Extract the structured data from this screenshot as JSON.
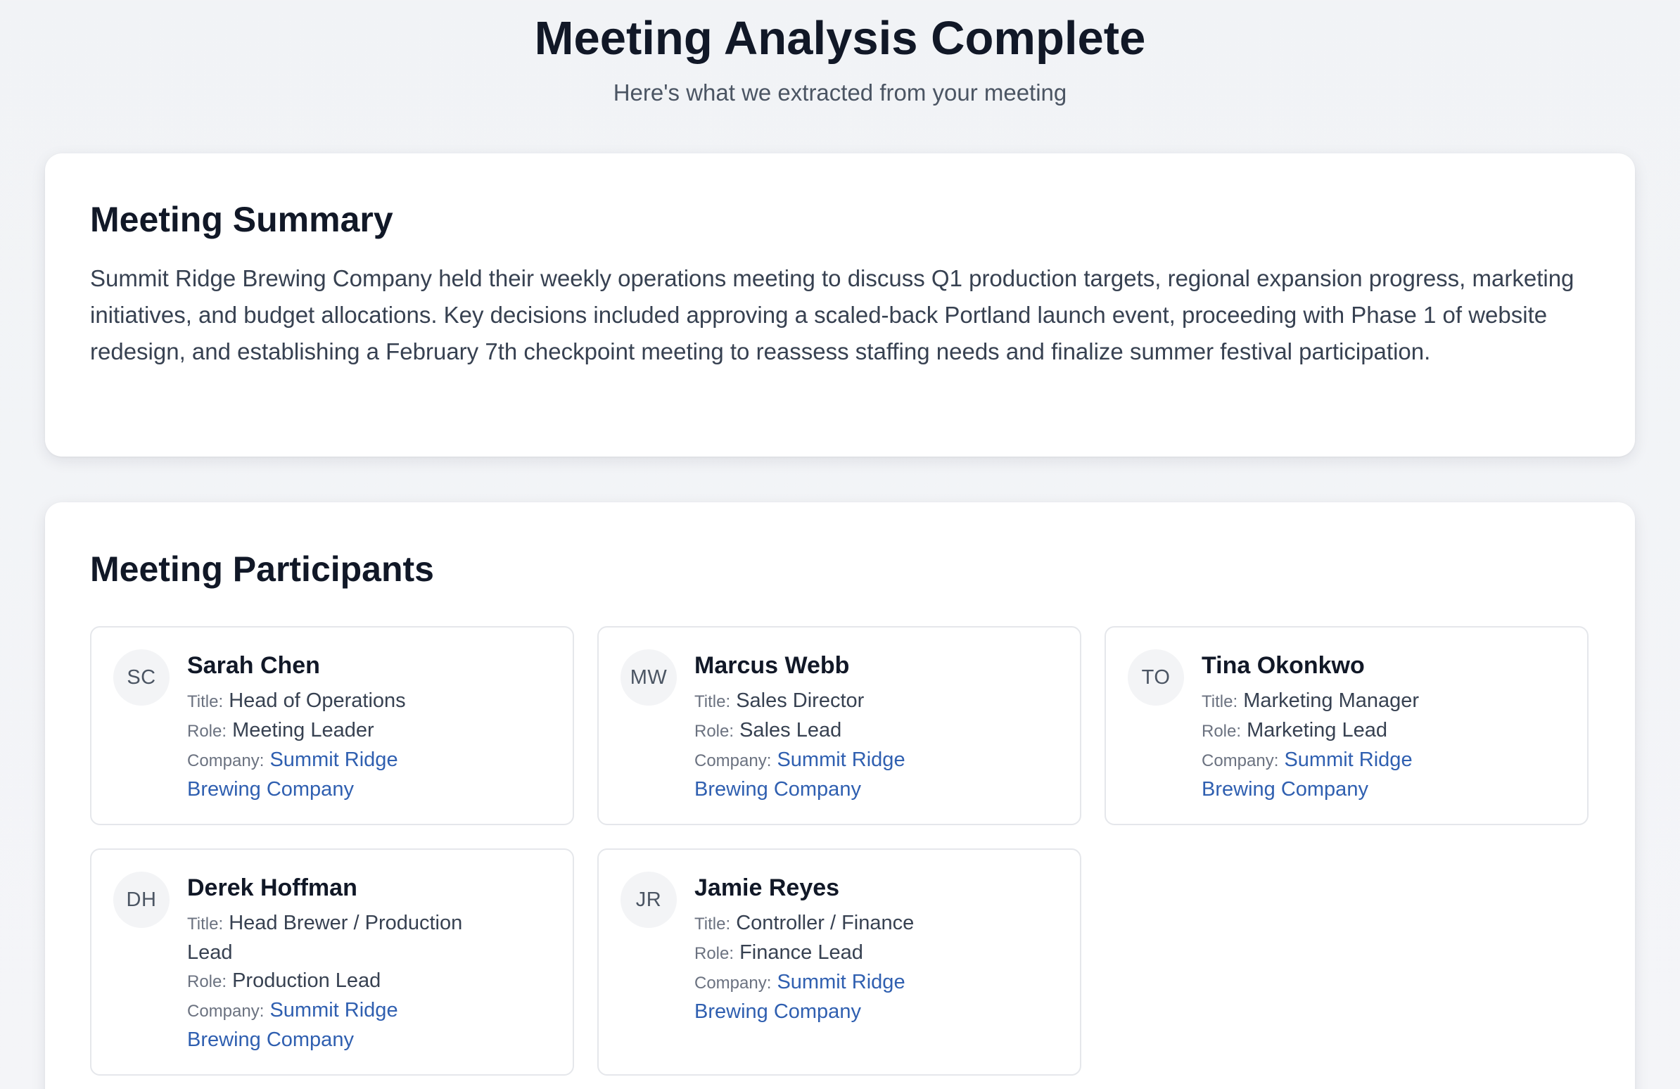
{
  "header": {
    "title": "Meeting Analysis Complete",
    "subtitle": "Here's what we extracted from your meeting"
  },
  "summary": {
    "title": "Meeting Summary",
    "text": "Summit Ridge Brewing Company held their weekly operations meeting to discuss Q1 production targets, regional expansion progress, marketing initiatives, and budget allocations. Key decisions included approving a scaled-back Portland launch event, proceeding with Phase 1 of website redesign, and establishing a February 7th checkpoint meeting to reassess staffing needs and finalize summer festival participation."
  },
  "participants": {
    "title": "Meeting Participants",
    "labels": {
      "title": "Title:",
      "role": "Role:",
      "company": "Company:"
    },
    "people": [
      {
        "initials": "SC",
        "name": "Sarah Chen",
        "title": "Head of Operations",
        "role": "Meeting Leader",
        "company": "Summit Ridge Brewing Company"
      },
      {
        "initials": "MW",
        "name": "Marcus Webb",
        "title": "Sales Director",
        "role": "Sales Lead",
        "company": "Summit Ridge Brewing Company"
      },
      {
        "initials": "TO",
        "name": "Tina Okonkwo",
        "title": "Marketing Manager",
        "role": "Marketing Lead",
        "company": "Summit Ridge Brewing Company"
      },
      {
        "initials": "DH",
        "name": "Derek Hoffman",
        "title": "Head Brewer / Production Lead",
        "role": "Production Lead",
        "company": "Summit Ridge Brewing Company"
      },
      {
        "initials": "JR",
        "name": "Jamie Reyes",
        "title": "Controller / Finance",
        "role": "Finance Lead",
        "company": "Summit Ridge Brewing Company"
      }
    ]
  }
}
